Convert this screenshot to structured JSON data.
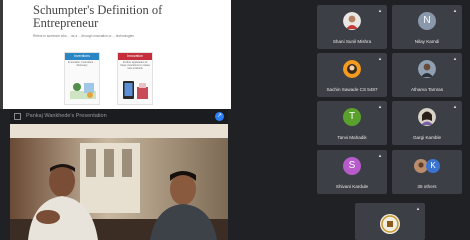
{
  "slide": {
    "title_line1": "Schumpter's Definition of",
    "title_line2": "Entrepreneur",
    "body": "Refers to someone who ... as a ... through innovation or ... technologies",
    "cards": [
      {
        "header": "Inventions",
        "description": "Innovation, Inventions ... discovery",
        "color": "#2b86c5"
      },
      {
        "header": "Innovation",
        "description": "Further application of these inventions to create new products",
        "color": "#c62d3a"
      }
    ]
  },
  "video": {
    "name_label": "Pankaj Wankhede's Presentation",
    "expand_icon": "expand-icon"
  },
  "participants": [
    {
      "name": "Shani Sunil Mishra",
      "avatar_type": "photo"
    },
    {
      "name": "Nilay Kamdi",
      "initial": "N",
      "color": "#8a98ac"
    },
    {
      "name": "Sachin Sawade CS 5487",
      "avatar_type": "photo"
    },
    {
      "name": "Atharva Tamras",
      "avatar_type": "photo"
    },
    {
      "name": "Tanvi Mahadik",
      "initial": "T",
      "color": "#5aa02c"
    },
    {
      "name": "Gargi Kamble",
      "avatar_type": "photo"
    },
    {
      "name": "Shivani Kardule",
      "initial": "S",
      "color": "#b65bc9"
    },
    {
      "name": "35 others",
      "avatar_type": "group",
      "initial": "K",
      "color": "#3b73d1"
    },
    {
      "name": "",
      "avatar_type": "logo"
    }
  ],
  "colors": {
    "tile": "#3c3f45",
    "background": "#1f2125",
    "accent": "#2d7ff9"
  }
}
